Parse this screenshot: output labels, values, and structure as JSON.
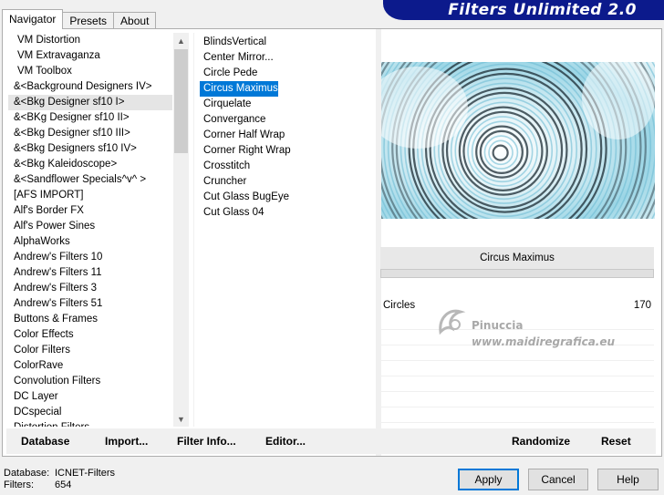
{
  "tabs": [
    {
      "label": "Navigator",
      "active": true
    },
    {
      "label": "Presets",
      "active": false
    },
    {
      "label": "About",
      "active": false
    }
  ],
  "brand": {
    "title": "Filters Unlimited 2.0"
  },
  "categories": [
    "VM Distortion",
    "VM Extravaganza",
    "VM Toolbox",
    "&<Background Designers IV>",
    "&<Bkg Designer sf10 I>",
    "&<BKg Designer sf10 II>",
    "&<Bkg Designer sf10 III>",
    "&<Bkg Designers sf10 IV>",
    "&<Bkg Kaleidoscope>",
    "&<Sandflower Specials^v^ >",
    "[AFS IMPORT]",
    "Alf's Border FX",
    "Alf's Power Sines",
    "AlphaWorks",
    "Andrew's Filters 10",
    "Andrew's Filters 11",
    "Andrew's Filters 3",
    "Andrew's Filters 51",
    "Buttons & Frames",
    "Color Effects",
    "Color Filters",
    "ColorRave",
    "Convolution Filters",
    "DC Layer",
    "DCspecial",
    "Distortion Filters"
  ],
  "selected_category_index": 4,
  "filters": [
    "BlindsVertical",
    "Center Mirror...",
    "Circle Pede",
    "Circus Maximus",
    "Cirquelate",
    "Convergance",
    "Corner Half Wrap",
    "Corner Right Wrap",
    "Crosstitch",
    "Cruncher",
    "Cut Glass  BugEye",
    "Cut Glass 04"
  ],
  "selected_filter_index": 3,
  "filter_panel": {
    "name": "Circus Maximus",
    "param_label": "Circles",
    "param_value": "170"
  },
  "watermark": {
    "name": "Pinuccia",
    "url": "www.maidiregrafica.eu"
  },
  "left_buttons": {
    "database": "Database",
    "import": "Import...",
    "filter_info": "Filter Info...",
    "editor": "Editor..."
  },
  "right_buttons": {
    "randomize": "Randomize",
    "reset": "Reset"
  },
  "footer": {
    "database_label": "Database:",
    "database_value": "ICNET-Filters",
    "filters_label": "Filters:",
    "filters_value": "654",
    "apply": "Apply",
    "cancel": "Cancel",
    "help": "Help"
  },
  "colors": {
    "selection": "#0078d7",
    "brand_bg": "#0c1a8c",
    "preview_cyan": "#7ec8dc"
  }
}
